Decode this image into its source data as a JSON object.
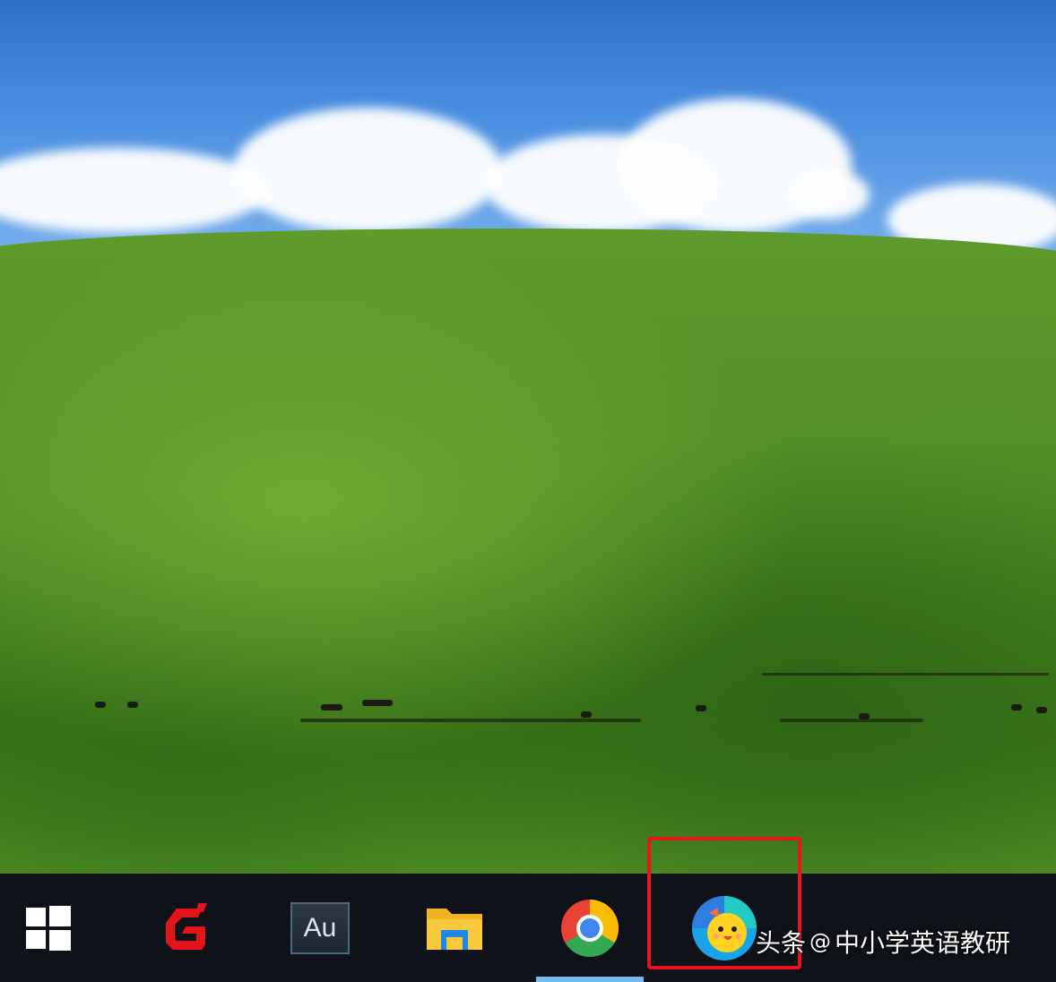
{
  "desktop": {
    "wallpaper": "green-hill-blue-sky",
    "colors": {
      "sky": "#4a8ee0",
      "grass": "#4d8a24"
    }
  },
  "taskbar": {
    "background": "#0f1218",
    "active_indicator_color": "#76b9ed",
    "start_icon": "windows-logo-icon",
    "apps": [
      {
        "name": "foxit-reader",
        "icon": "foxit-g-icon"
      },
      {
        "name": "adobe-audition",
        "icon": "audition-icon",
        "label": "Au"
      },
      {
        "name": "file-explorer",
        "icon": "folder-icon"
      },
      {
        "name": "google-chrome",
        "icon": "chrome-icon",
        "active": true
      },
      {
        "name": "game-app",
        "icon": "chick-game-icon"
      }
    ]
  },
  "annotation": {
    "highlight_color": "#e8161b"
  },
  "watermark": {
    "source": "头条",
    "at": "@",
    "author": "中小学英语教研"
  }
}
